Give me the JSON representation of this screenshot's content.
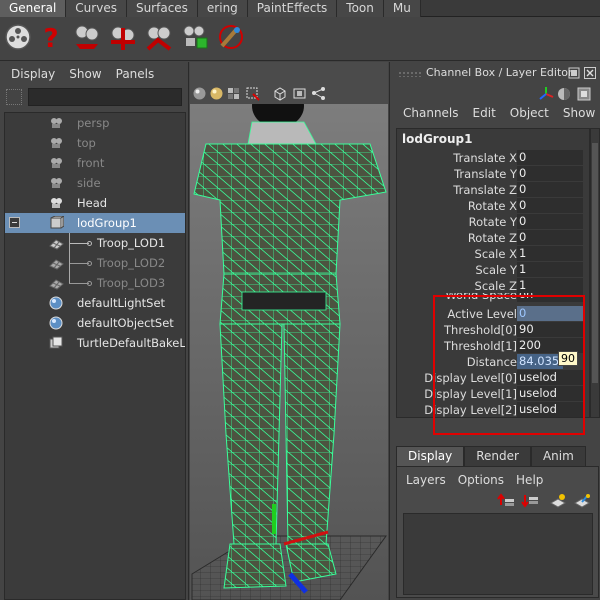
{
  "shelf": {
    "tabs": [
      "General",
      "Curves",
      "Surfaces",
      "ering",
      "PaintEffects",
      "Toon",
      "Mu"
    ],
    "active_tab": "General",
    "icons": [
      "film-reel-icon",
      "help-question-icon",
      "lod-group-icon",
      "lod-fx-icon",
      "lod-tools-icon",
      "lod-paint-icon",
      "lod-brush-icon"
    ]
  },
  "outliner": {
    "menu": [
      "Display",
      "Show",
      "Panels"
    ],
    "search_value": "",
    "items": [
      {
        "label": "persp",
        "icon": "camera-icon",
        "dim": true
      },
      {
        "label": "top",
        "icon": "camera-icon",
        "dim": true
      },
      {
        "label": "front",
        "icon": "camera-icon",
        "dim": true
      },
      {
        "label": "side",
        "icon": "camera-icon",
        "dim": true
      },
      {
        "label": "Head",
        "icon": "camera-icon",
        "dim": false
      },
      {
        "label": "lodGroup1",
        "icon": "lod-group-icon",
        "dim": false,
        "selected": true
      },
      {
        "label": "Troop_LOD1",
        "icon": "mesh-icon",
        "dim": false
      },
      {
        "label": "Troop_LOD2",
        "icon": "mesh-icon",
        "dim": true
      },
      {
        "label": "Troop_LOD3",
        "icon": "mesh-icon",
        "dim": true
      },
      {
        "label": "defaultLightSet",
        "icon": "set-sphere-icon",
        "dim": false
      },
      {
        "label": "defaultObjectSet",
        "icon": "set-sphere-icon",
        "dim": false
      },
      {
        "label": "TurtleDefaultBakeLa",
        "icon": "bake-layer-icon",
        "dim": false
      }
    ]
  },
  "channel_box": {
    "title": "Channel Box / Layer Editor",
    "menu": [
      "Channels",
      "Edit",
      "Object",
      "Show"
    ],
    "node_name": "lodGroup1",
    "attributes": [
      {
        "name": "Translate X",
        "value": "0"
      },
      {
        "name": "Translate Y",
        "value": "0"
      },
      {
        "name": "Translate Z",
        "value": "0"
      },
      {
        "name": "Rotate X",
        "value": "0"
      },
      {
        "name": "Rotate Y",
        "value": "0"
      },
      {
        "name": "Rotate Z",
        "value": "0"
      },
      {
        "name": "Scale X",
        "value": "1"
      },
      {
        "name": "Scale Y",
        "value": "1"
      },
      {
        "name": "Scale Z",
        "value": "1"
      },
      {
        "name": "World Space",
        "value": "on"
      },
      {
        "name": "Active Level",
        "value": "0",
        "highlight": true
      },
      {
        "name": "Threshold[0]",
        "value": "90"
      },
      {
        "name": "Threshold[1]",
        "value": "200"
      },
      {
        "name": "Distance",
        "value": "84.035",
        "selected": true
      },
      {
        "name": "Display Level[0]",
        "value": "uselod"
      },
      {
        "name": "Display Level[1]",
        "value": "uselod"
      },
      {
        "name": "Display Level[2]",
        "value": "uselod"
      }
    ],
    "tooltip": "90"
  },
  "layer_editor": {
    "tabs": [
      "Display",
      "Render",
      "Anim"
    ],
    "active_tab": "Display",
    "menu": [
      "Layers",
      "Options",
      "Help"
    ]
  },
  "colors": {
    "wireframe": "#39ff9a",
    "selection_blue": "#6b8fb5",
    "highlight_box": "#e00000"
  }
}
